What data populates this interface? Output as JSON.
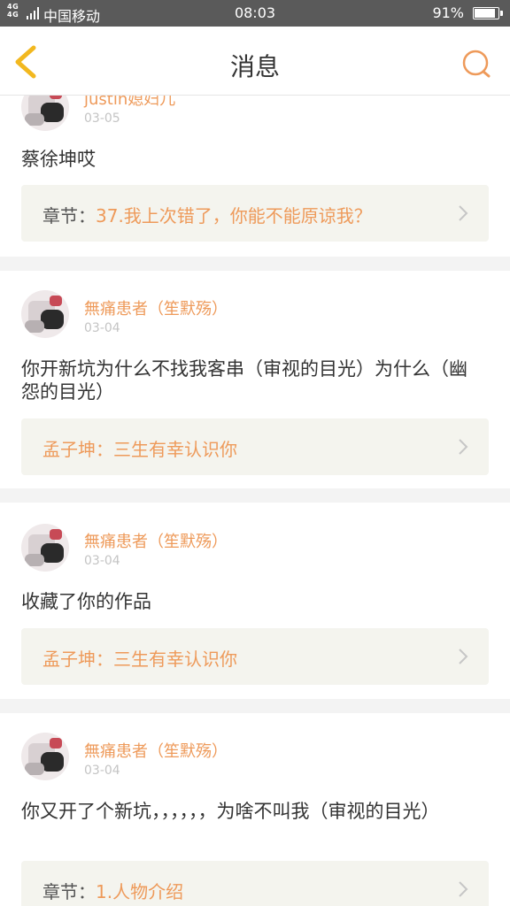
{
  "status_bar": {
    "network": "4G",
    "carrier": "中国移动",
    "time": "08:03",
    "battery_percent": "91%",
    "battery_level": 0.91
  },
  "nav": {
    "title": "消息",
    "back_icon": "chevron-left-icon",
    "search_icon": "search-icon"
  },
  "colors": {
    "accent": "#ee9a5a",
    "back_icon": "#f2b81f",
    "status_bar_bg": "#5a5a5a",
    "ref_bg": "#f4f4ee",
    "separator": "#f3f3f3"
  },
  "messages": [
    {
      "user": "justin媳妇儿",
      "date": "03-05",
      "content": "蔡徐坤哎",
      "ref_label": "章节：",
      "ref_value": "37.我上次错了，你能不能原谅我？"
    },
    {
      "user": "無痛患者（笙默殇）",
      "date": "03-04",
      "content": "你开新坑为什么不找我客串（审视的目光）为什么（幽怨的目光）",
      "ref_label": "",
      "ref_value": "孟子坤：三生有幸认识你"
    },
    {
      "user": "無痛患者（笙默殇）",
      "date": "03-04",
      "content": "收藏了你的作品",
      "ref_label": "",
      "ref_value": "孟子坤：三生有幸认识你"
    },
    {
      "user": "無痛患者（笙默殇）",
      "date": "03-04",
      "content": "你又开了个新坑，，，，，，为啥不叫我（审视的目光）",
      "ref_label": "章节：",
      "ref_value": "1.人物介绍"
    }
  ]
}
